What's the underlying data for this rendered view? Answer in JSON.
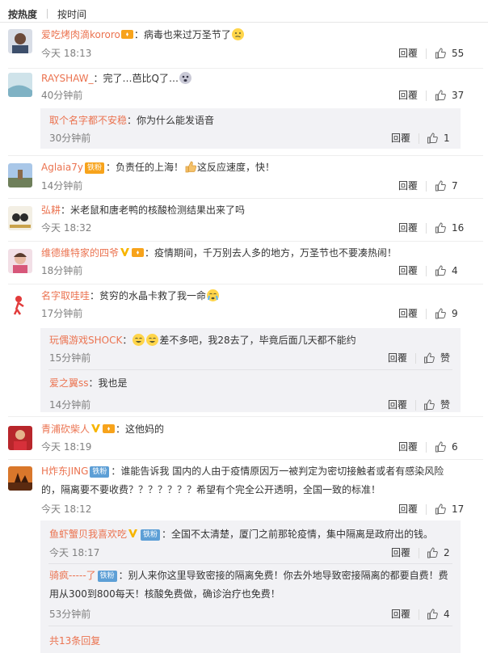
{
  "sort": {
    "hot": "按热度",
    "time": "按时间"
  },
  "labels": {
    "reply": "回覆"
  },
  "comments": [
    {
      "user": "爱吃烤肉滴kororo",
      "text": "：病毒也来过万圣节了",
      "time": "今天 18:13",
      "likes": "55"
    },
    {
      "user": "RAYSHAW_",
      "text": "：完了…芭比Q了…",
      "time": "40分钟前",
      "likes": "37",
      "replies": [
        {
          "user": "取个名字都不安稳",
          "text": "：你为什么能发语音",
          "time": "30分钟前",
          "likes": "1"
        }
      ]
    },
    {
      "user": "Aglaia7y",
      "badge": "铁粉",
      "text": "：负责任的上海！",
      "text2": "这反应速度，快！",
      "time": "14分钟前",
      "likes": "7"
    },
    {
      "user": "弘耕",
      "text": "：米老鼠和唐老鸭的核酸检测结果出来了吗",
      "time": "今天 18:32",
      "likes": "16"
    },
    {
      "user": "维德维特家的四爷",
      "text": "：疫情期间，千万别去人多的地方，万圣节也不要凑热闹！",
      "time": "18分钟前",
      "likes": "4"
    },
    {
      "user": "名字取哇哇",
      "text": "：贫穷的水晶卡救了我一命",
      "time": "17分钟前",
      "likes": "9",
      "replies": [
        {
          "user": "玩偶游戏SHOCK",
          "text": "差不多吧，我28去了，毕竟后面几天都不能约",
          "time": "15分钟前",
          "likes": "赞"
        },
        {
          "user": "爱之翼ss",
          "text": "：我也是",
          "time": "14分钟前",
          "likes": "赞"
        }
      ]
    },
    {
      "user": "青浦砍柴人",
      "text": "：这他妈的",
      "time": "今天 18:19",
      "likes": "6"
    },
    {
      "user": "H炸东JING",
      "badge": "铁粉",
      "text": "：谁能告诉我 国内的人由于疫情原因万一被判定为密切接触者或者有感染风险",
      "text2": "的，隔离要不要收费？？？？？？？希望有个完全公开透明，全国一致的标准！",
      "time": "今天 18:12",
      "likes": "17",
      "replies": [
        {
          "user": "鱼虾蟹贝我喜欢吃",
          "badge": "铁粉",
          "text": "：全国不太清楚，厦门之前那轮疫情，集中隔离是政府出的钱。",
          "time": "今天 18:17",
          "likes": "2"
        },
        {
          "user": "骑疯-----了",
          "badge": "铁粉",
          "text": "：别人来你这里导致密接的隔离免费！你去外地导致密接隔离的都要自费！费",
          "text2": "用从300到800每天！核酸免费做，确诊治疗也免费！",
          "time": "53分钟前",
          "likes": "4"
        }
      ],
      "more": "共13条回复"
    }
  ],
  "colors": {
    "username": "#eb7350",
    "badge": "#f7a31b",
    "verified": "#f7b500",
    "reply_bg": "#f2f2f5"
  }
}
